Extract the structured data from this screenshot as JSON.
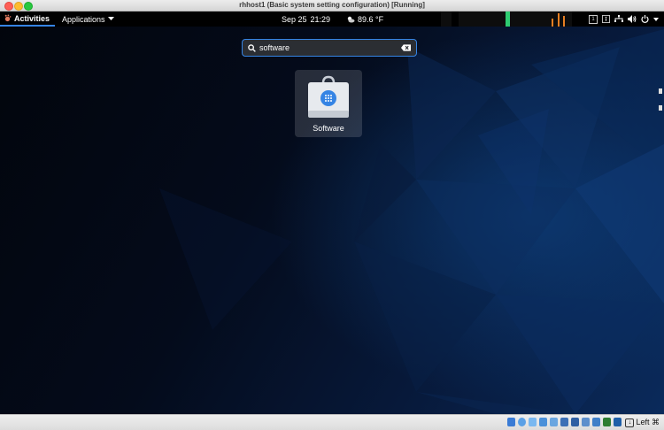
{
  "window": {
    "title": "rhhost1 (Basic system setting configuration) [Running]"
  },
  "topbar": {
    "activities_label": "Activities",
    "applications_label": "Applications",
    "date": "Sep 25",
    "time": "21:29",
    "weather": "89.6 °F",
    "tray_icons": [
      "workspace-1-indicator",
      "accessibility-icon",
      "network-icon",
      "volume-icon",
      "power-icon",
      "menu-arrow-icon"
    ],
    "workspace_number": "1"
  },
  "search": {
    "value": "software",
    "placeholder": ""
  },
  "results": [
    {
      "label": "Software",
      "icon": "software-bag-icon"
    }
  ],
  "statusbar": {
    "host_key_label": "Left ⌘"
  },
  "colors": {
    "accent": "#3584e4",
    "topbar": "#000000",
    "desktop_dark": "#040b1b",
    "desktop_blue": "#0a2a5b"
  }
}
